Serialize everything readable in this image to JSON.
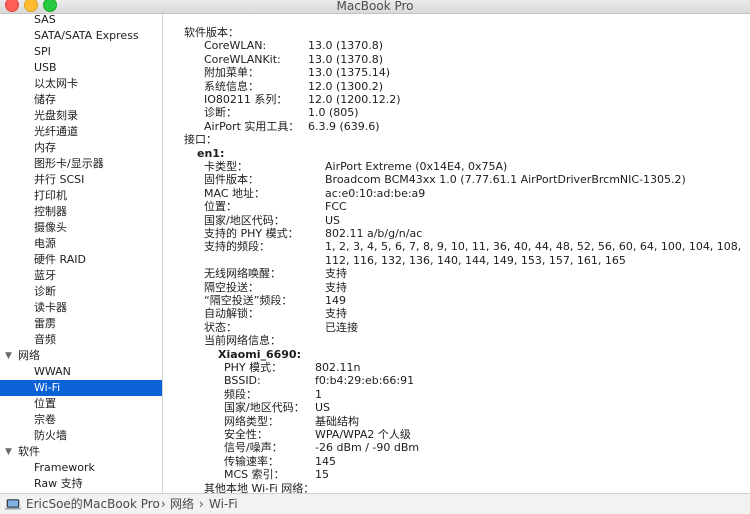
{
  "window": {
    "title": "MacBook Pro"
  },
  "sidebar": {
    "items": [
      {
        "label": "SAS",
        "level": 1
      },
      {
        "label": "SATA/SATA Express",
        "level": 1
      },
      {
        "label": "SPI",
        "level": 1
      },
      {
        "label": "USB",
        "level": 1
      },
      {
        "label": "以太网卡",
        "level": 1
      },
      {
        "label": "储存",
        "level": 1
      },
      {
        "label": "光盘刻录",
        "level": 1
      },
      {
        "label": "光纤通道",
        "level": 1
      },
      {
        "label": "内存",
        "level": 1
      },
      {
        "label": "图形卡/显示器",
        "level": 1
      },
      {
        "label": "并行 SCSI",
        "level": 1
      },
      {
        "label": "打印机",
        "level": 1
      },
      {
        "label": "控制器",
        "level": 1
      },
      {
        "label": "摄像头",
        "level": 1
      },
      {
        "label": "电源",
        "level": 1
      },
      {
        "label": "硬件 RAID",
        "level": 1
      },
      {
        "label": "蓝牙",
        "level": 1
      },
      {
        "label": "诊断",
        "level": 1
      },
      {
        "label": "读卡器",
        "level": 1
      },
      {
        "label": "雷雳",
        "level": 1
      },
      {
        "label": "音频",
        "level": 1
      },
      {
        "label": "网络",
        "level": 0,
        "expanded": true
      },
      {
        "label": "WWAN",
        "level": 1
      },
      {
        "label": "Wi-Fi",
        "level": 1,
        "selected": true
      },
      {
        "label": "位置",
        "level": 1
      },
      {
        "label": "宗卷",
        "level": 1
      },
      {
        "label": "防火墙",
        "level": 1
      },
      {
        "label": "软件",
        "level": 0,
        "expanded": true
      },
      {
        "label": "Framework",
        "level": 1
      },
      {
        "label": "Raw 支持",
        "level": 1
      }
    ]
  },
  "detail": {
    "software_header": "软件版本：",
    "software": [
      {
        "k": "CoreWLAN:",
        "v": "13.0 (1370.8)"
      },
      {
        "k": "CoreWLANKit:",
        "v": "13.0 (1370.8)"
      },
      {
        "k": "附加菜单：",
        "v": "13.0 (1375.14)"
      },
      {
        "k": "系统信息：",
        "v": "12.0 (1300.2)"
      },
      {
        "k": "IO80211 系列：",
        "v": "12.0 (1200.12.2)"
      },
      {
        "k": "诊断：",
        "v": "1.0 (805)"
      },
      {
        "k": "AirPort 实用工具：",
        "v": "6.3.9 (639.6)"
      }
    ],
    "interfaces_header": "接口：",
    "interface_name": "en1:",
    "interface": [
      {
        "k": "卡类型：",
        "v": "AirPort Extreme  (0x14E4, 0x75A)"
      },
      {
        "k": "固件版本：",
        "v": "Broadcom BCM43xx 1.0 (7.77.61.1 AirPortDriverBrcmNIC-1305.2)"
      },
      {
        "k": "MAC 地址：",
        "v": "ac:e0:10:ad:be:a9"
      },
      {
        "k": "位置：",
        "v": "FCC"
      },
      {
        "k": "国家/地区代码：",
        "v": "US"
      },
      {
        "k": "支持的 PHY 模式：",
        "v": "802.11 a/b/g/n/ac"
      },
      {
        "k": "支持的频段：",
        "v": "1, 2, 3, 4, 5, 6, 7, 8, 9, 10, 11, 36, 40, 44, 48, 52, 56, 60, 64, 100, 104, 108,",
        "v2": "112, 116, 132, 136, 140, 144, 149, 153, 157, 161, 165"
      },
      {
        "k": "无线网络唤醒：",
        "v": "支持"
      },
      {
        "k": "隔空投送：",
        "v": "支持"
      },
      {
        "k": "“隔空投送”频段：",
        "v": "149"
      },
      {
        "k": "自动解锁：",
        "v": "支持"
      },
      {
        "k": "状态：",
        "v": "已连接"
      }
    ],
    "current_network_header": "当前网络信息：",
    "network_name": "Xiaomi_6690:",
    "network": [
      {
        "k": "PHY 模式：",
        "v": "802.11n"
      },
      {
        "k": "BSSID:",
        "v": "f0:b4:29:eb:66:91"
      },
      {
        "k": "频段：",
        "v": "1"
      },
      {
        "k": "国家/地区代码：",
        "v": "US"
      },
      {
        "k": "网络类型：",
        "v": "基础结构"
      },
      {
        "k": "安全性：",
        "v": "WPA/WPA2 个人级"
      },
      {
        "k": "信号/噪声：",
        "v": "-26 dBm / -90 dBm"
      },
      {
        "k": "传输速率：",
        "v": "145"
      },
      {
        "k": "MCS 索引：",
        "v": "15"
      }
    ],
    "other_networks_header": "其他本地 Wi-Fi 网络："
  },
  "statusbar": {
    "crumbs": [
      "EricSoe的MacBook Pro",
      "网络",
      "Wi-Fi"
    ],
    "separator": "›"
  }
}
